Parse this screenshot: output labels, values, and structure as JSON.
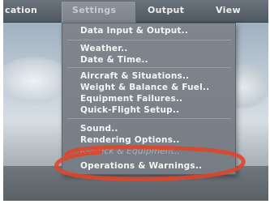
{
  "menubar": {
    "items": [
      {
        "label": "cation"
      },
      {
        "label": "Settings"
      },
      {
        "label": "Output"
      },
      {
        "label": "View"
      }
    ]
  },
  "settings_menu": {
    "items": [
      {
        "label": "Data Input & Output.."
      },
      {
        "label": "Weather.."
      },
      {
        "label": "Date & Time.."
      },
      {
        "label": "Aircraft & Situations.."
      },
      {
        "label": "Weight & Balance & Fuel.."
      },
      {
        "label": "Equipment Failures.."
      },
      {
        "label": "Quick-Flight Setup.."
      },
      {
        "label": "Sound.."
      },
      {
        "label": "Rendering Options.."
      },
      {
        "label": "Joystick & Equipment.."
      },
      {
        "label": "Operations & Warnings.."
      }
    ]
  },
  "colors": {
    "highlight": "#e0452b"
  }
}
